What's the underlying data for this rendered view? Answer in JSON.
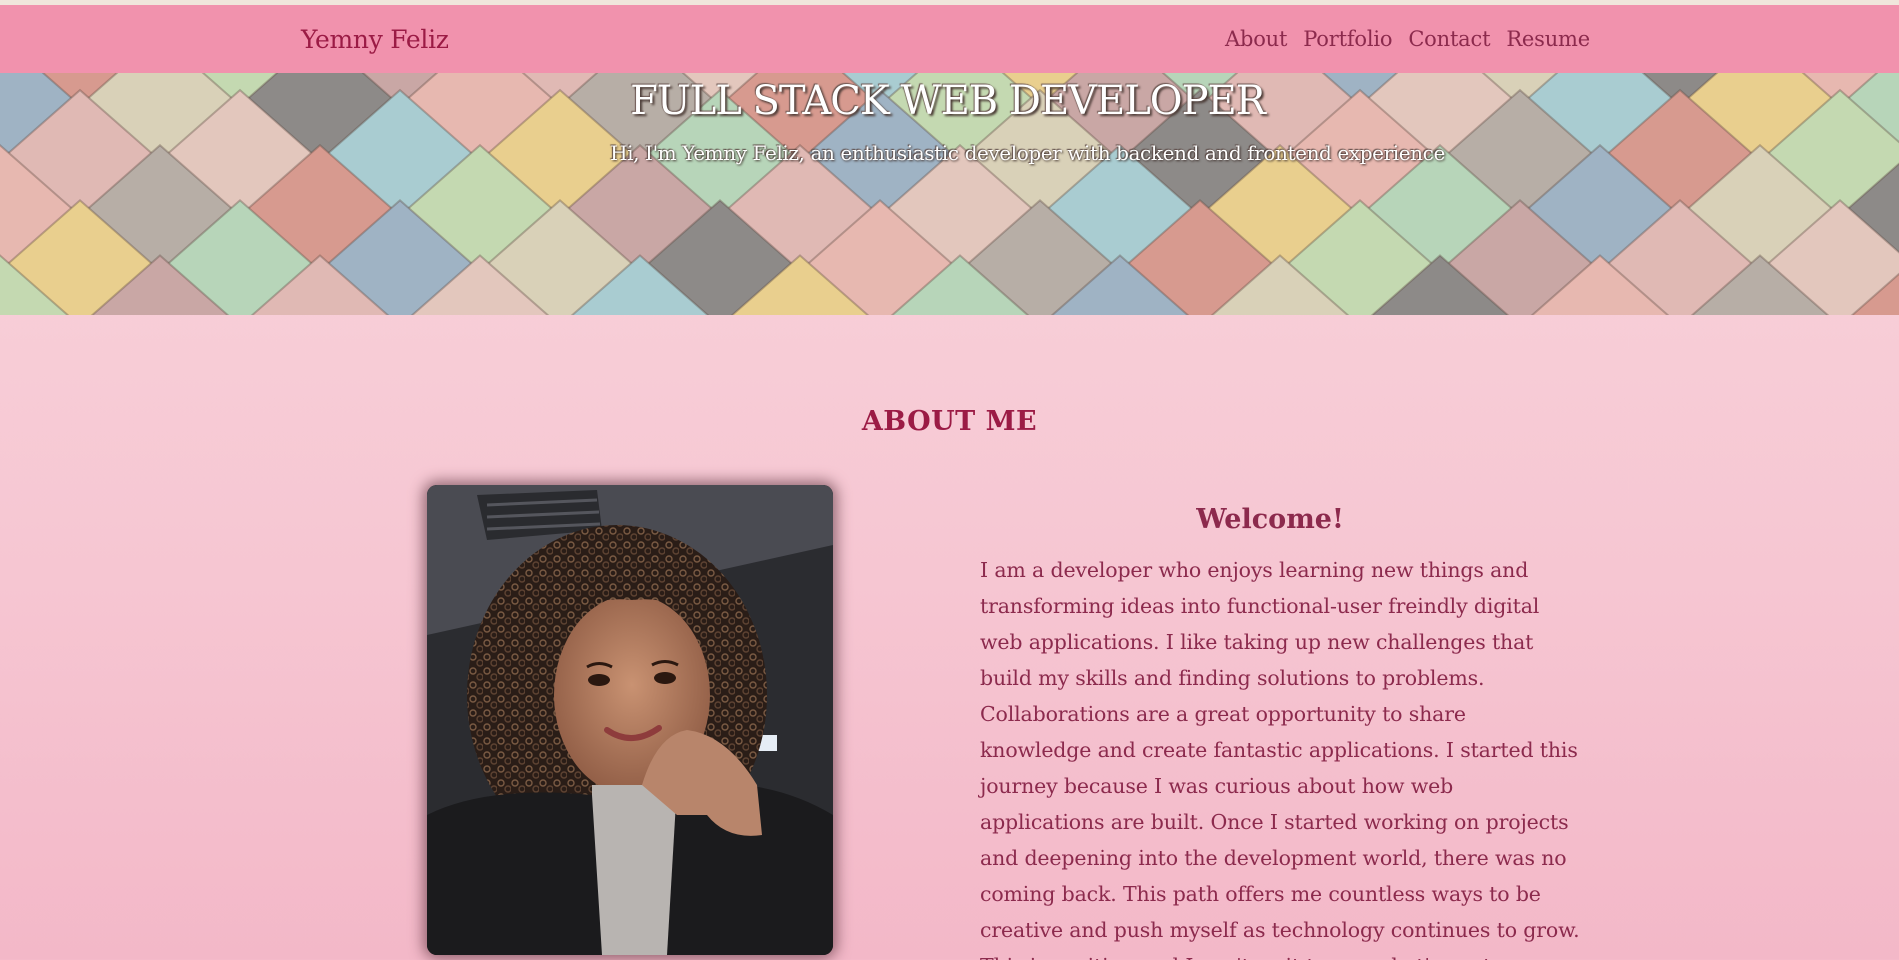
{
  "nav": {
    "brand": "Yemny Feliz",
    "links": [
      "About",
      "Portfolio",
      "Contact",
      "Resume"
    ]
  },
  "hero": {
    "title": "FULL STACK WEB DEVELOPER",
    "subtitle": "Hi, I'm Yemny Feliz, an enthusiastic developer with backend and frontend experience"
  },
  "about": {
    "heading": "ABOUT ME",
    "welcome": "Welcome!",
    "bio": "I am a developer who enjoys learning new things and transforming ideas into functional-user freindly digital web applications. I like taking up new challenges that build my skills and finding solutions to problems. Collaborations are a great opportunity to share knowledge and create fantastic applications. I started this journey because I was curious about how web applications are built. Once I started working on projects and deepening into the development world, there was no coming back. This path offers me countless ways to be creative and push myself as technology continues to grow. This is exciting and I can't wait to see what's next."
  },
  "colors": {
    "navbar": "#f192ad",
    "brand": "#9b1b45",
    "text": "#8c2a4d",
    "page_background": "#f7cbd6"
  }
}
